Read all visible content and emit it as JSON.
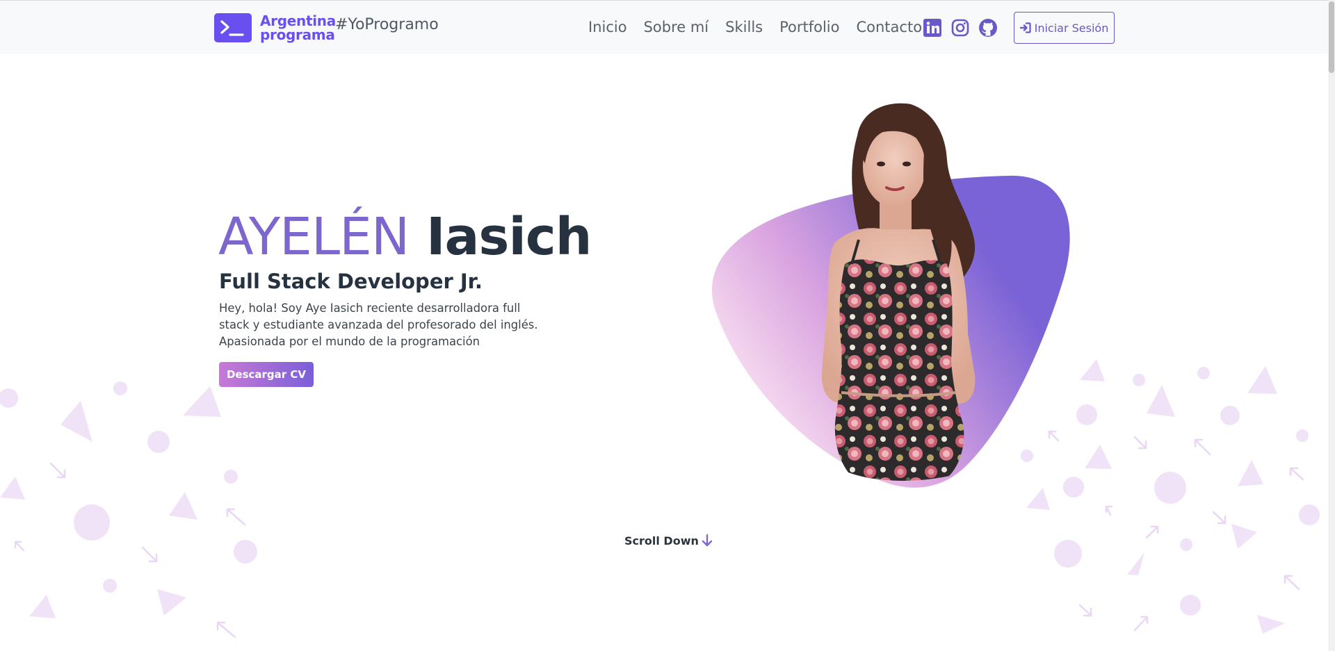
{
  "brand": {
    "name_line1": "Argentina",
    "name_line2": "programa",
    "hashtag": "#YoProgramo",
    "logo_icon": "terminal-icon",
    "color": "#6a4ff0"
  },
  "nav": {
    "links": [
      "Inicio",
      "Sobre mí",
      "Skills",
      "Portfolio",
      "Contacto"
    ],
    "social_icons": [
      "linkedin-icon",
      "instagram-icon",
      "github-icon"
    ],
    "social_color": "#6a58c9",
    "login_label": "Iniciar Sesión",
    "login_icon": "sign-in-icon"
  },
  "hero": {
    "first_name": "AYELÉN",
    "last_name": "Iasich",
    "role": "Full Stack Developer Jr.",
    "description": "Hey, hola! Soy Aye Iasich reciente desarrolladora full stack y estudiante avanzada del profesorado del inglés. Apasionada por el mundo de la programación",
    "cv_button": "Descargar CV",
    "portrait_icon": "profile-photo",
    "accent_color": "#7e66cf",
    "blob_gradient": [
      "#fde8f3",
      "#d9a3e0",
      "#7a63d6"
    ]
  },
  "scroll": {
    "label": "Scroll Down",
    "icon": "arrow-down-icon"
  }
}
